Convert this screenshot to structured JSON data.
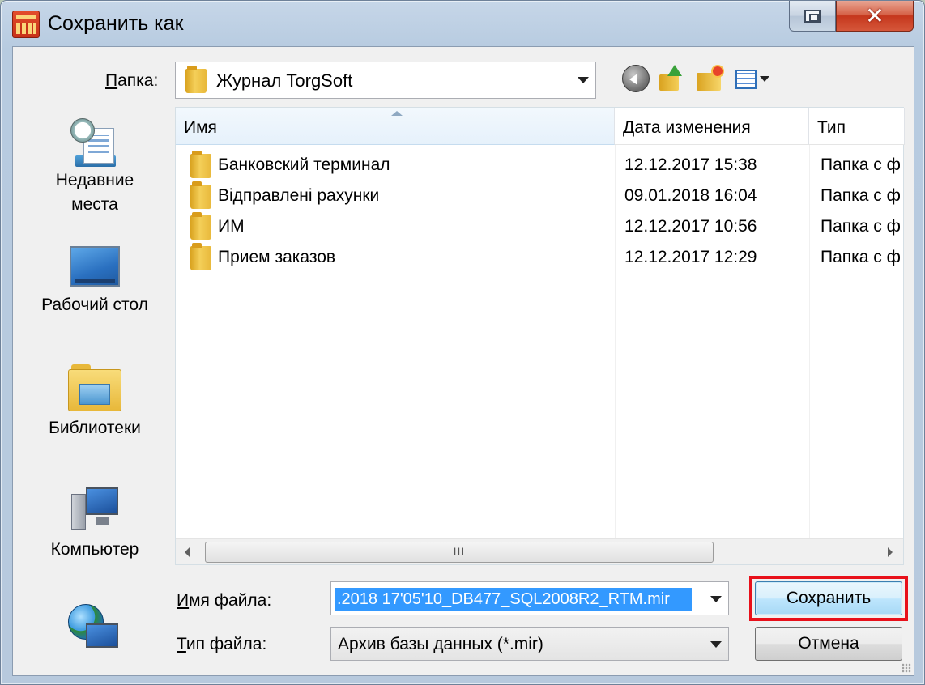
{
  "window": {
    "title": "Сохранить как"
  },
  "toolbar": {
    "folder_label": "Папка:",
    "folder_access_key": "П",
    "folder_label_rest": "апка:",
    "current_folder": "Журнал TorgSoft",
    "icons": [
      "back-icon",
      "up-folder-icon",
      "new-folder-icon",
      "views-menu-icon"
    ]
  },
  "places": [
    {
      "label_line1": "Недавние",
      "label_line2": "места",
      "icon": "recent-places-icon"
    },
    {
      "label_line1": "Рабочий стол",
      "label_line2": "",
      "icon": "desktop-icon"
    },
    {
      "label_line1": "Библиотеки",
      "label_line2": "",
      "icon": "libraries-icon"
    },
    {
      "label_line1": "Компьютер",
      "label_line2": "",
      "icon": "computer-icon"
    },
    {
      "label_line1": "",
      "label_line2": "",
      "icon": "network-icon"
    }
  ],
  "file_list": {
    "columns": {
      "name": "Имя",
      "date": "Дата изменения",
      "type": "Тип"
    },
    "rows": [
      {
        "name": "Банковский терминал",
        "date": "12.12.2017 15:38",
        "type": "Папка с ф"
      },
      {
        "name": "Відправлені рахунки",
        "date": "09.01.2018 16:04",
        "type": "Папка с ф"
      },
      {
        "name": "ИМ",
        "date": "12.12.2017 10:56",
        "type": "Папка с ф"
      },
      {
        "name": "Прием заказов",
        "date": "12.12.2017 12:29",
        "type": "Папка с ф"
      }
    ],
    "scroll_thumb_glyph": "III"
  },
  "form": {
    "filename_label_key": "И",
    "filename_label_rest": "мя файла:",
    "filename_value": ".2018 17'05'10_DB477_SQL2008R2_RTM.mir",
    "filetype_label_key": "Т",
    "filetype_label_rest": "ип файла:",
    "filetype_value": "Архив базы данных (*.mir)",
    "save_label": "Сохранить",
    "cancel_label": "Отмена"
  },
  "colors": {
    "selection": "#3399ff",
    "highlight_box": "#e8101a",
    "close_button": "#c5361c"
  }
}
